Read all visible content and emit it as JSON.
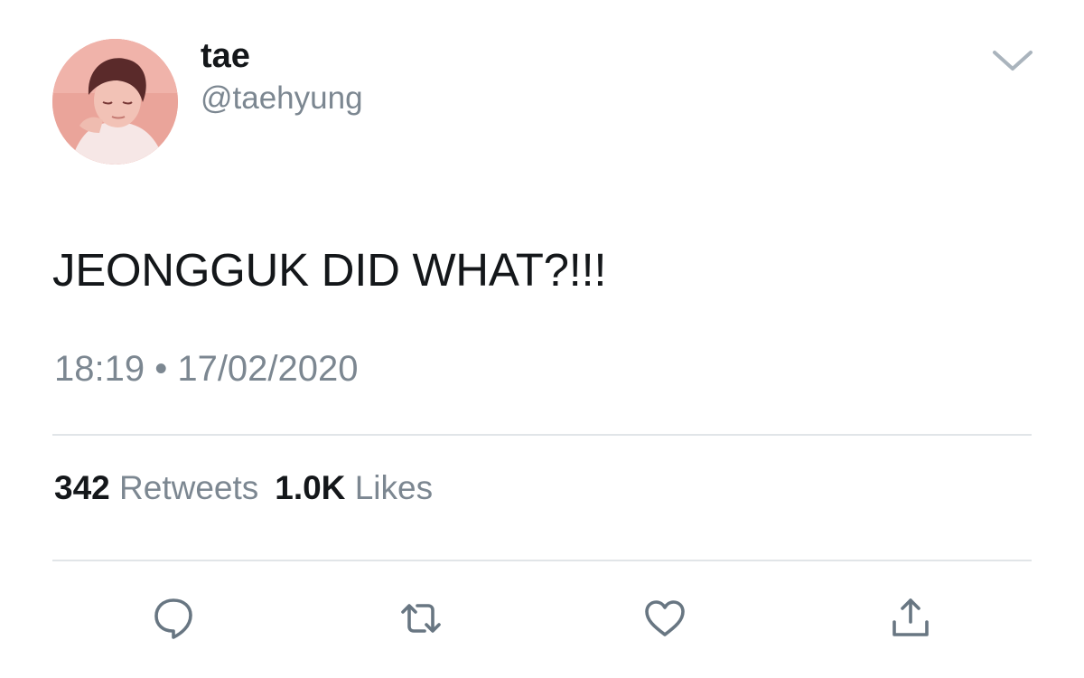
{
  "author": {
    "display_name": "tae",
    "handle": "@taehyung"
  },
  "tweet": {
    "text": "JEONGGUK DID WHAT?!!!",
    "timestamp": "18:19 • 17/02/2020"
  },
  "stats": {
    "retweets_count": "342",
    "retweets_label": "Retweets",
    "likes_count": "1.0K",
    "likes_label": "Likes"
  },
  "icons": {
    "menu": "chevron-down-icon",
    "reply": "reply-icon",
    "retweet": "retweet-icon",
    "like": "heart-icon",
    "share": "share-icon"
  },
  "colors": {
    "text_primary": "#14171a",
    "text_secondary": "#7c8791",
    "icon": "#687682",
    "divider": "#e1e5e8",
    "avatar_bg": "#eaa49a"
  }
}
